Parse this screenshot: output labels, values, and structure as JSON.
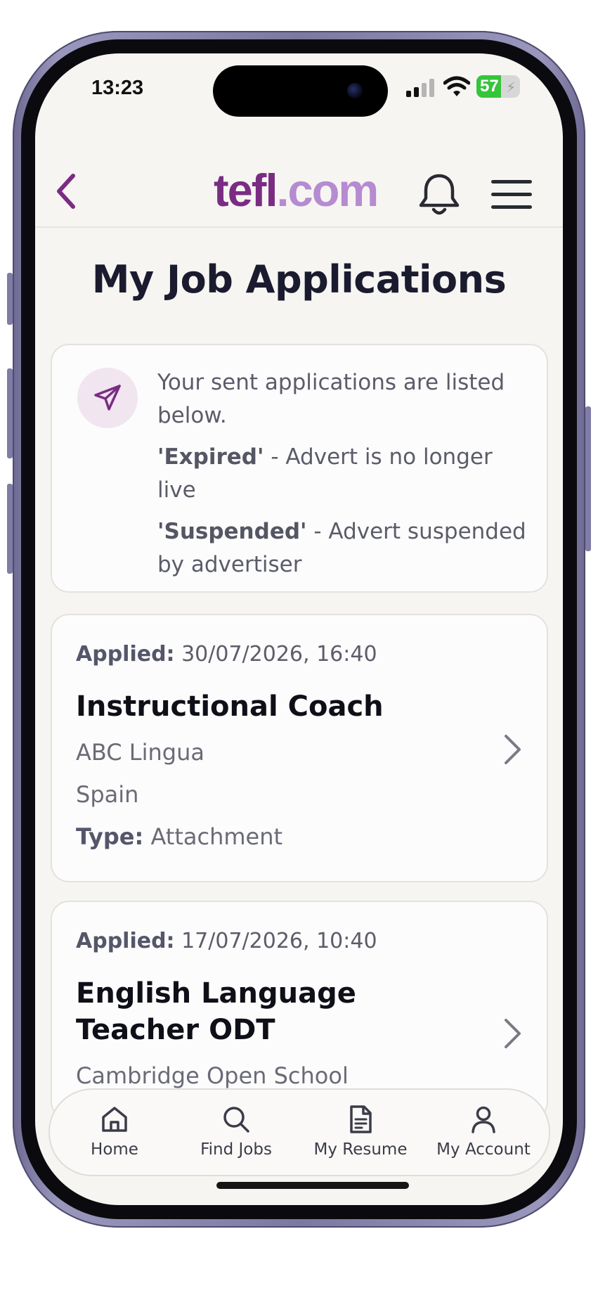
{
  "status_bar": {
    "time": "13:23",
    "battery_percent": "57",
    "battery_level": 0.57,
    "signal_icon": "cellular-signal-icon",
    "wifi_icon": "wifi-icon"
  },
  "header": {
    "back_icon": "chevron-left-icon",
    "logo_part1": "tefl",
    "logo_part2": ".com",
    "notifications_icon": "bell-icon",
    "menu_icon": "hamburger-menu-icon"
  },
  "page": {
    "title": "My Job Applications"
  },
  "info": {
    "icon": "paper-plane-icon",
    "intro": "Your sent applications are listed below.",
    "expired_term": "'Expired'",
    "expired_desc": " - Advert is no longer live",
    "suspended_term": "'Suspended'",
    "suspended_desc": " - Advert suspended by advertiser"
  },
  "applications": [
    {
      "applied_label": "Applied:",
      "applied_date": " 30/07/2026, 16:40",
      "title": "Instructional Coach",
      "company": "ABC Lingua",
      "location": "Spain",
      "type_label": "Type:",
      "type_value": " Attachment"
    },
    {
      "applied_label": "Applied:",
      "applied_date": " 17/07/2026, 10:40",
      "title": "English Language Teacher ODT",
      "company": "Cambridge Open School"
    }
  ],
  "bottom_nav": {
    "items": [
      {
        "label": "Home",
        "icon": "home-icon"
      },
      {
        "label": "Find Jobs",
        "icon": "search-icon"
      },
      {
        "label": "My Resume",
        "icon": "document-icon"
      },
      {
        "label": "My Account",
        "icon": "user-icon"
      }
    ]
  },
  "colors": {
    "brand_primary": "#7a2c83",
    "brand_secondary": "#b58bd1",
    "battery_green": "#35c53a",
    "title_dark": "#1a1b2e",
    "phone_frame": "#7b78a2"
  }
}
